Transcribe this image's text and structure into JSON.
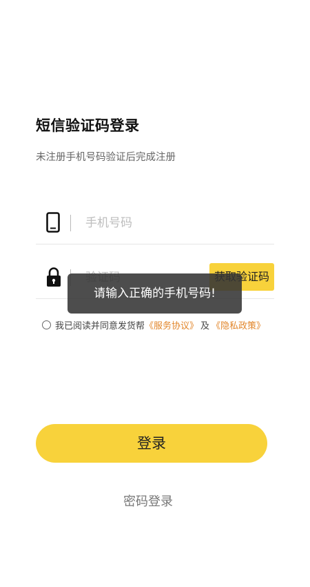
{
  "header": {
    "title": "短信验证码登录",
    "subtitle": "未注册手机号码验证后完成注册"
  },
  "phone_field": {
    "icon": "phone-icon",
    "placeholder": "手机号码",
    "value": ""
  },
  "code_field": {
    "icon": "lock-icon",
    "placeholder": "验证码",
    "value": "",
    "get_code_label": "获取验证码"
  },
  "agreement": {
    "checked": false,
    "prefix": "我已阅读并同意发货帮",
    "service_link": "《服务协议》",
    "and_text": "及",
    "privacy_link": "《隐私政策》"
  },
  "toast": {
    "message": "请输入正确的手机号码!"
  },
  "actions": {
    "login_label": "登录",
    "password_login_label": "密码登录"
  },
  "colors": {
    "accent": "#f8d23b",
    "link": "#e2862b",
    "toast_bg": "#343434"
  }
}
